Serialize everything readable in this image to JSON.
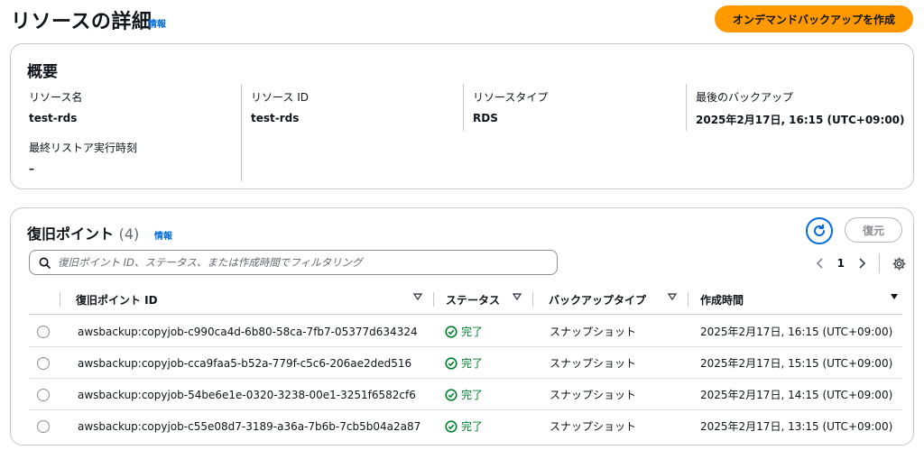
{
  "header": {
    "title": "リソースの詳細",
    "info_label": "情報",
    "primary_button": "オンデマンドバックアップを作成"
  },
  "summary": {
    "title": "概要",
    "fields": [
      {
        "label": "リソース名",
        "value": "test-rds"
      },
      {
        "label": "リソース ID",
        "value": "test-rds"
      },
      {
        "label": "リソースタイプ",
        "value": "RDS"
      },
      {
        "label": "最後のバックアップ",
        "value": "2025年2月17日, 16:15 (UTC+09:00)"
      },
      {
        "label": "最終リストア実行時刻",
        "value": "–"
      }
    ]
  },
  "recovery_points": {
    "title": "復旧ポイント",
    "count": "(4)",
    "info_label": "情報",
    "restore_button": "復元",
    "filter_placeholder": "復旧ポイント ID、ステータス、または作成時間でフィルタリング",
    "page": "1",
    "columns": [
      "復旧ポイント ID",
      "ステータス",
      "バックアップタイプ",
      "作成時間"
    ],
    "rows": [
      {
        "id": "awsbackup:copyjob-c990ca4d-6b80-58ca-7fb7-05377d634324",
        "status": "完了",
        "type": "スナップショット",
        "created": "2025年2月17日, 16:15 (UTC+09:00)"
      },
      {
        "id": "awsbackup:copyjob-cca9faa5-b52a-779f-c5c6-206ae2ded516",
        "status": "完了",
        "type": "スナップショット",
        "created": "2025年2月17日, 15:15 (UTC+09:00)"
      },
      {
        "id": "awsbackup:copyjob-54be6e1e-0320-3238-00e1-3251f6582cf6",
        "status": "完了",
        "type": "スナップショット",
        "created": "2025年2月17日, 14:15 (UTC+09:00)"
      },
      {
        "id": "awsbackup:copyjob-c55e08d7-3189-a36a-7b6b-7cb5b04a2a87",
        "status": "完了",
        "type": "スナップショット",
        "created": "2025年2月17日, 13:15 (UTC+09:00)"
      }
    ]
  },
  "colors": {
    "accent": "#006ce0",
    "primary_button": "#ff9900",
    "success": "#00802f",
    "border": "#c6c6cd"
  },
  "icons": [
    "search-icon",
    "refresh-icon",
    "chevron-left-icon",
    "chevron-right-icon",
    "gear-icon",
    "sort-caret-icon",
    "check-circle-icon"
  ]
}
